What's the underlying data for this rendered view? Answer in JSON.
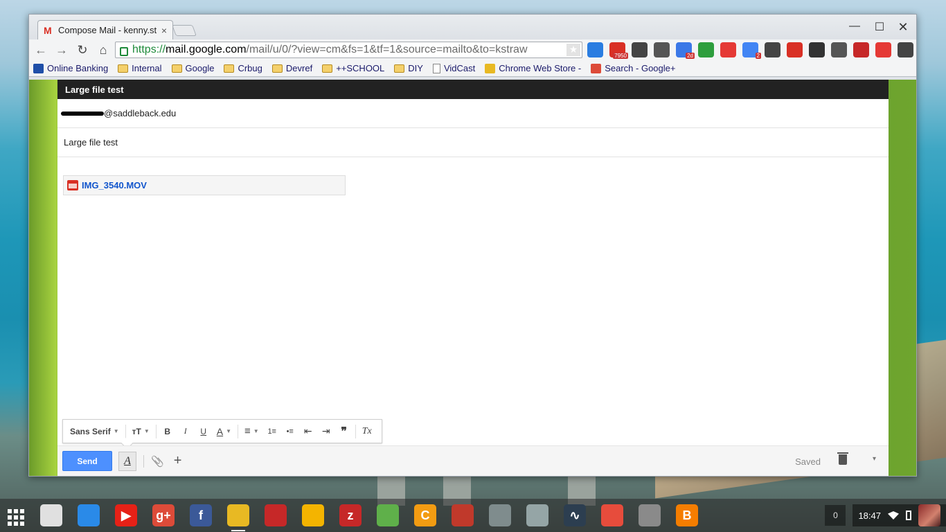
{
  "browser": {
    "tab_title": "Compose Mail - kenny.st",
    "tab_close": "×",
    "window_controls": {
      "minimize": "—",
      "maximize": "☐",
      "close": "✕"
    },
    "nav": {
      "back": "←",
      "forward": "→",
      "reload": "↻",
      "home": "⌂"
    },
    "url": {
      "scheme": "https://",
      "host": "mail.google.com",
      "path": "/mail/u/0/?view=cm&fs=1&tf=1&source=mailto&to=kstraw"
    },
    "star": "★",
    "extensions": [
      {
        "icon": "plus-badge-icon",
        "color": "#2a7de1",
        "badge": ""
      },
      {
        "icon": "gmail-checker-icon",
        "color": "#d93025",
        "badge": "7950"
      },
      {
        "icon": "speech-bubble-icon",
        "color": "#444444",
        "badge": ""
      },
      {
        "icon": "github-icon",
        "color": "#555555",
        "badge": ""
      },
      {
        "icon": "calendar-icon",
        "color": "#3b78e7",
        "badge": "2d"
      },
      {
        "icon": "leaf-icon",
        "color": "#2e9e3d",
        "badge": ""
      },
      {
        "icon": "download-icon",
        "color": "#e53935",
        "badge": ""
      },
      {
        "icon": "google-plus-notif-icon",
        "color": "#4285f4",
        "badge": "2"
      },
      {
        "icon": "shield-icon",
        "color": "#444444",
        "badge": ""
      },
      {
        "icon": "share-icon",
        "color": "#d93025",
        "badge": ""
      },
      {
        "icon": "film-icon",
        "color": "#333333",
        "badge": ""
      },
      {
        "icon": "cast-icon",
        "color": "#555555",
        "badge": ""
      },
      {
        "icon": "heart-icon",
        "color": "#c62828",
        "badge": ""
      },
      {
        "icon": "adblock-plus-icon",
        "color": "#e53935",
        "badge": ""
      },
      {
        "icon": "menu-icon",
        "color": "#444444",
        "badge": ""
      }
    ],
    "bookmarks": [
      {
        "label": "Online Banking",
        "icon": "bank-icon"
      },
      {
        "label": "Internal",
        "icon": "folder-icon"
      },
      {
        "label": "Google",
        "icon": "folder-icon"
      },
      {
        "label": "Crbug",
        "icon": "folder-icon"
      },
      {
        "label": "Devref",
        "icon": "folder-icon"
      },
      {
        "label": "++SCHOOL",
        "icon": "folder-icon"
      },
      {
        "label": "DIY",
        "icon": "folder-icon"
      },
      {
        "label": "VidCast",
        "icon": "page-icon"
      },
      {
        "label": "Chrome Web Store -",
        "icon": "chrome-store-icon"
      },
      {
        "label": "Search - Google+",
        "icon": "google-plus-icon"
      }
    ]
  },
  "compose": {
    "header_title": "Large file test",
    "to_value": "@saddleback.edu",
    "subject_value": "Large file test",
    "attachment_name": "IMG_3540.MOV",
    "format_bar": {
      "font_label": "Sans Serif",
      "size_label": "тT",
      "bold": "B",
      "italic": "I",
      "underline": "U",
      "text_color": "A",
      "align": "≡",
      "numbered_list": "1≡",
      "bulleted_list": "•≡",
      "indent_less": "⇤",
      "indent_more": "⇥",
      "quote": "❞",
      "remove_formatting": "Tx"
    },
    "send_label": "Send",
    "format_toggle": "A",
    "attach_icon": "📎",
    "more_icon": "+",
    "saved_label": "Saved",
    "more_caret": "▾"
  },
  "shelf": {
    "apps": [
      {
        "icon": "chrome-web-store-icon",
        "color": "#e0e0e0",
        "glyph": ""
      },
      {
        "icon": "files-icon",
        "color": "#2a8ae8",
        "glyph": ""
      },
      {
        "icon": "youtube-icon",
        "color": "#e62117",
        "glyph": "▶"
      },
      {
        "icon": "google-plus-icon",
        "color": "#dd4b39",
        "glyph": "g+"
      },
      {
        "icon": "facebook-icon",
        "color": "#3b5998",
        "glyph": "f"
      },
      {
        "icon": "chrome-icon",
        "color": "#e8b923",
        "glyph": ""
      },
      {
        "icon": "video-player-icon",
        "color": "#c62828",
        "glyph": ""
      },
      {
        "icon": "headphones-icon",
        "color": "#f4b400",
        "glyph": ""
      },
      {
        "icon": "no-sleep-icon",
        "color": "#c62828",
        "glyph": "z"
      },
      {
        "icon": "maps-icon",
        "color": "#5fb04a",
        "glyph": ""
      },
      {
        "icon": "c-app-icon",
        "color": "#f39c12",
        "glyph": "C"
      },
      {
        "icon": "toolbox-icon",
        "color": "#c0392b",
        "glyph": ""
      },
      {
        "icon": "cube-app-icon",
        "color": "#7f8c8d",
        "glyph": ""
      },
      {
        "icon": "cube-app-2-icon",
        "color": "#95a5a6",
        "glyph": ""
      },
      {
        "icon": "pulse-icon",
        "color": "#2c3e50",
        "glyph": "∿"
      },
      {
        "icon": "sunset-icon",
        "color": "#e74c3c",
        "glyph": ""
      },
      {
        "icon": "chrome-tools-icon",
        "color": "#8a8a8a",
        "glyph": ""
      },
      {
        "icon": "blogger-icon",
        "color": "#f57d00",
        "glyph": "B"
      }
    ],
    "notification_count": "0",
    "time": "18:47"
  }
}
